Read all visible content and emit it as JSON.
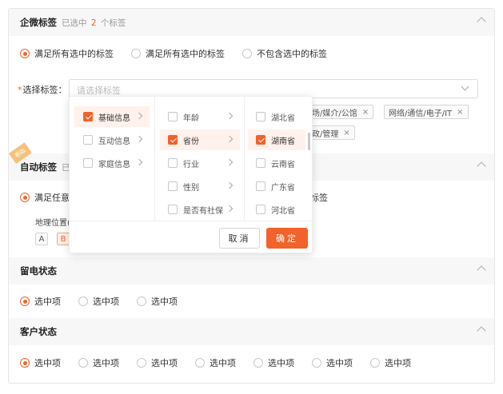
{
  "colors": {
    "accent": "#f2622a",
    "header_bg": "#f7f7f8",
    "border": "#e6e6e6"
  },
  "qw_section": {
    "title": "企微标签",
    "sub_prefix": "已选中",
    "sub_count": "2",
    "sub_suffix": "个标签",
    "options": [
      "满足所有选中的标签",
      "满足所有选中的标签",
      "不包含选中的标签"
    ],
    "selected_index": 0,
    "field_required": "*",
    "field_label": "选择标签：",
    "select_placeholder": "请选择标签",
    "tags": [
      "市场/媒介/公馆",
      "网络/通信/电子/IT",
      "行政/管理"
    ],
    "tag_remove": "×"
  },
  "auto_section": {
    "title": "自动标签",
    "sub": "已",
    "option_visible": "满足任意",
    "option_tail": "标签",
    "geo_label": "地理位置(",
    "mini_tags": [
      "A",
      "B"
    ],
    "badge": "新版"
  },
  "dropdown": {
    "col1": [
      {
        "label": "基础信息",
        "checked": true
      },
      {
        "label": "互动信息",
        "checked": false
      },
      {
        "label": "家庭信息",
        "checked": false
      }
    ],
    "col2": [
      {
        "label": "年龄",
        "checked": false
      },
      {
        "label": "省份",
        "checked": true
      },
      {
        "label": "行业",
        "checked": false
      },
      {
        "label": "性别",
        "checked": false
      },
      {
        "label": "是否有社保",
        "checked": false
      }
    ],
    "col3": [
      {
        "label": "湖北省",
        "checked": false
      },
      {
        "label": "湖南省",
        "checked": true
      },
      {
        "label": "云南省",
        "checked": false
      },
      {
        "label": "广东省",
        "checked": false
      },
      {
        "label": "河北省",
        "checked": false
      }
    ],
    "cancel_label": "取消",
    "ok_label": "确定"
  },
  "call_section": {
    "title": "留电状态",
    "options": [
      "选中项",
      "选中项",
      "选中项"
    ],
    "selected_index": 0
  },
  "customer_section": {
    "title": "客户状态",
    "options": [
      "选中项",
      "选中项",
      "选中项",
      "选中项",
      "选中项",
      "选中项",
      "选中项"
    ],
    "selected_index": 0
  }
}
